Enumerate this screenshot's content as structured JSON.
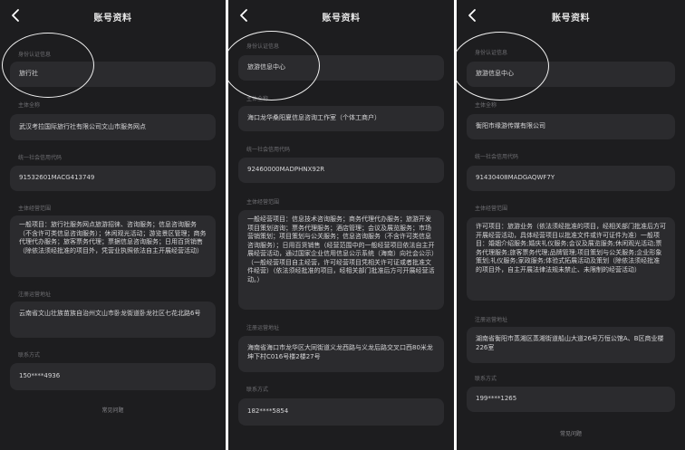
{
  "panels": [
    {
      "title": "账号资料",
      "identity_label": "身份认证信息",
      "identity_value": "旅行社",
      "entity_label": "主体全称",
      "entity_value": "武汉考拉国际旅行社有限公司文山市服务网点",
      "credit_label": "统一社会信用代码",
      "credit_value": "91532601MACG413749",
      "scope_label": "主体经营范围",
      "scope_value": "一般项目：旅行社服务网点旅游招徕、咨询服务；信息咨询服务（不含许可类信息咨询服务）；休闲观光活动；游览景区管理；商务代理代办服务；旅客票务代理；票据信息咨询服务；日用百货销售（除依法须经批准的项目外，凭营业执照依法自主开展经营活动）",
      "address_label": "注册运营地址",
      "address_value": "云南省文山壮族苗族自治州文山市卧龙街道卧龙社区七花北路6号",
      "contact_label": "联系方式",
      "contact_value": "150****4936",
      "footer": "常见问题"
    },
    {
      "title": "账号资料",
      "identity_label": "身份认证信息",
      "identity_value": "旅游信息中心",
      "entity_label": "主体全称",
      "entity_value": "海口龙华桑阳夏信息咨询工作室（个体工商户）",
      "credit_label": "统一社会信用代码",
      "credit_value": "92460000MADPHNX92R",
      "scope_label": "主体经营范围",
      "scope_value": "一般经营项目：信息技术咨询服务；商务代理代办服务；旅游开发项目策划咨询；票务代理服务；酒店管理；会议及展览服务；市场营销策划；项目策划与公关服务；信息咨询服务（不含许可类信息咨询服务）；日用百货销售（经营范围中的一般经营项目依法自主开展经营活动，通过国家企业信用信息公示系统（海南）向社会公示）（一般经营项目自主经营，许可经营项目凭相关许可证或者批准文件经营）（依法须经批准的项目，经相关部门批准后方可开展经营活动。）",
      "address_label": "注册运营地址",
      "address_value": "海南省海口市龙华区大同街道义龙西路与义龙后路交叉口西80米龙坤下村C016号楼2楼27号",
      "contact_label": "联系方式",
      "contact_value": "182****5854",
      "footer": ""
    },
    {
      "title": "账号资料",
      "identity_label": "身份认证信息",
      "identity_value": "旅游信息中心",
      "entity_label": "主体全称",
      "entity_value": "衡阳市缘游传媒有限公司",
      "credit_label": "统一社会信用代码",
      "credit_value": "91430408MADGAQWF7Y",
      "scope_label": "主体经营范围",
      "scope_value": "许可项目：旅游业务（依法须经批准的项目，经相关部门批准后方可开展经营活动，具体经营项目以批准文件或许可证件为准）一般项目：婚姻介绍服务;婚庆礼仪服务;会议及展览服务;休闲观光活动;票务代理服务;旅客票务代理;品牌管理;项目策划与公关服务;企业形象策划;礼仪服务;家政服务;体验式拓展活动及策划（除依法须经批准的项目外，自主开展法律法规未禁止、未限制的经营活动）",
      "address_label": "注册运营地址",
      "address_value": "湖南省衡阳市蒸湘区蒸湘街道船山大道26号万恒公馆A、B区商业楼226室",
      "contact_label": "联系方式",
      "contact_value": "199****1265",
      "footer": "常见问题"
    }
  ]
}
